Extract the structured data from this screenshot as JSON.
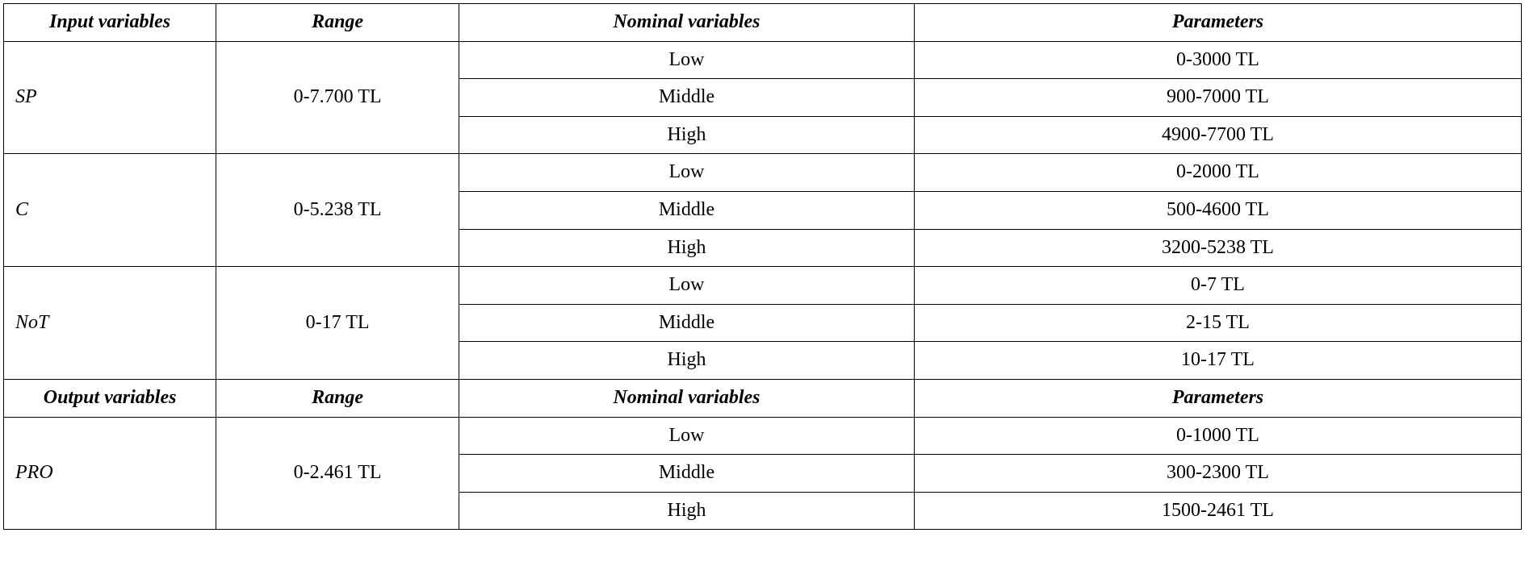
{
  "headers": {
    "input_variables": "Input variables",
    "output_variables": "Output variables",
    "range": "Range",
    "nominal_variables": "Nominal variables",
    "parameters": "Parameters"
  },
  "input_rows": [
    {
      "variable": "SP",
      "range": "0-7.700 TL",
      "levels": [
        {
          "nominal": "Low",
          "parameter": "0-3000 TL"
        },
        {
          "nominal": "Middle",
          "parameter": "900-7000 TL"
        },
        {
          "nominal": "High",
          "parameter": "4900-7700 TL"
        }
      ]
    },
    {
      "variable": "C",
      "range": "0-5.238 TL",
      "levels": [
        {
          "nominal": "Low",
          "parameter": "0-2000 TL"
        },
        {
          "nominal": "Middle",
          "parameter": "500-4600 TL"
        },
        {
          "nominal": "High",
          "parameter": "3200-5238 TL"
        }
      ]
    },
    {
      "variable": "NoT",
      "range": "0-17 TL",
      "levels": [
        {
          "nominal": "Low",
          "parameter": "0-7 TL"
        },
        {
          "nominal": "Middle",
          "parameter": "2-15 TL"
        },
        {
          "nominal": "High",
          "parameter": "10-17 TL"
        }
      ]
    }
  ],
  "output_rows": [
    {
      "variable": "PRO",
      "range": "0-2.461 TL",
      "levels": [
        {
          "nominal": "Low",
          "parameter": "0-1000 TL"
        },
        {
          "nominal": "Middle",
          "parameter": "300-2300 TL"
        },
        {
          "nominal": "High",
          "parameter": "1500-2461 TL"
        }
      ]
    }
  ]
}
